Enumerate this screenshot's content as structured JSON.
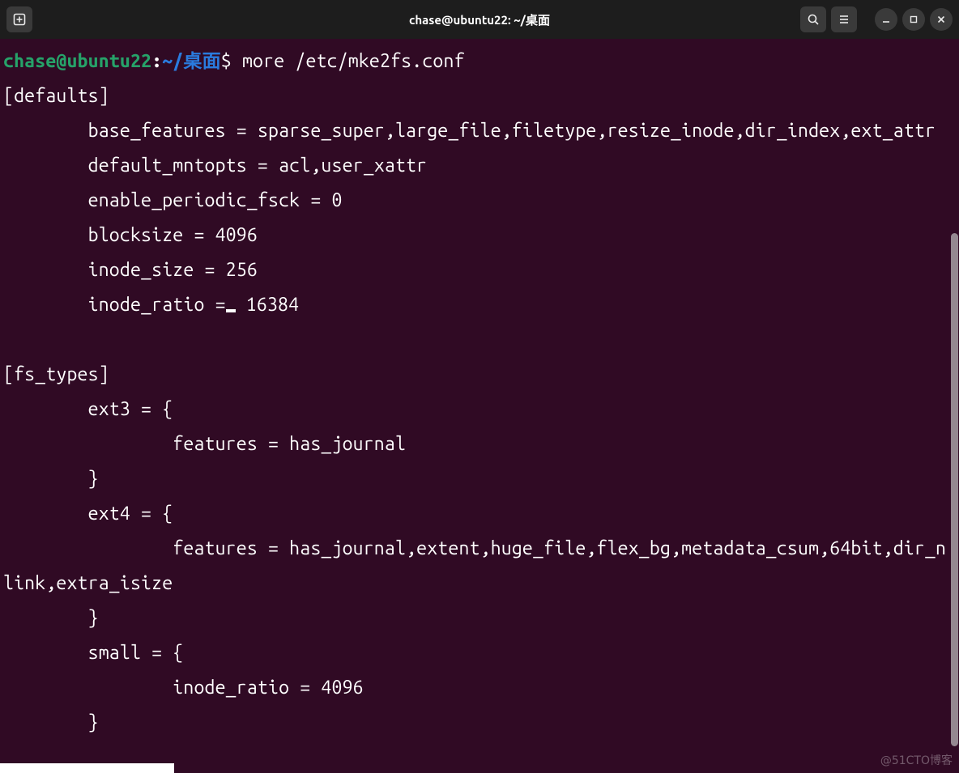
{
  "window": {
    "title": "chase@ubuntu22: ~/桌面"
  },
  "prompt": {
    "user_host": "chase@ubuntu22",
    "separator": ":",
    "path": "~/桌面",
    "symbol": "$",
    "command": "more /etc/mke2fs.conf"
  },
  "output": {
    "section_defaults": "[defaults]",
    "defaults": {
      "base_features_key": "base_features",
      "base_features_val": "sparse_super,large_file,filetype,resize_inode,dir_index,ext_attr",
      "default_mntopts_key": "default_mntopts",
      "default_mntopts_val": "acl,user_xattr",
      "enable_periodic_fsck_key": "enable_periodic_fsck",
      "enable_periodic_fsck_val": "0",
      "blocksize_key": "blocksize",
      "blocksize_val": "4096",
      "inode_size_key": "inode_size",
      "inode_size_val": "256",
      "inode_ratio_key": "inode_ratio",
      "inode_ratio_val": "16384"
    },
    "section_fstypes": "[fs_types]",
    "fs_types": {
      "ext3_key": "ext3",
      "ext3_features_key": "features",
      "ext3_features_val": "has_journal",
      "ext4_key": "ext4",
      "ext4_features_key": "features",
      "ext4_features_val": "has_journal,extent,huge_file,flex_bg,metadata_csum,64bit,dir_nlink,extra_isize",
      "small_key": "small",
      "small_inode_ratio_key": "inode_ratio",
      "small_inode_ratio_val": "4096"
    },
    "eq": " = ",
    "brace_open": "{",
    "brace_close": "}"
  },
  "watermark": "@51CTO博客"
}
